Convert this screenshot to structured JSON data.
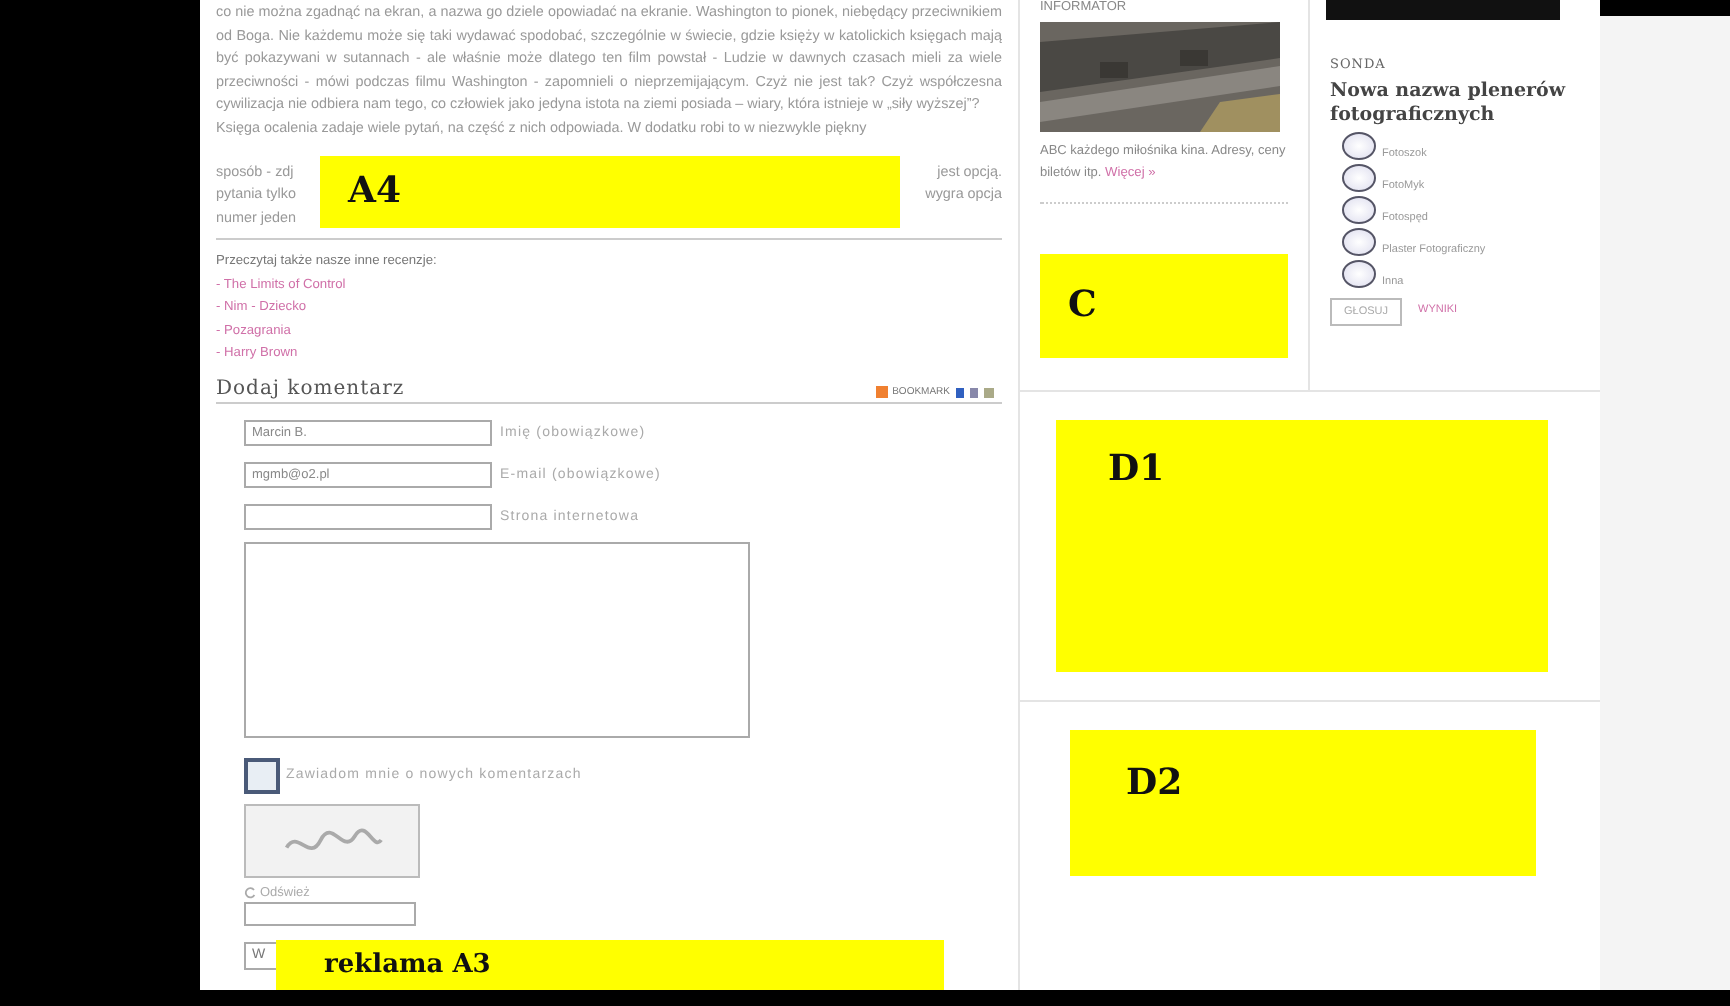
{
  "article": {
    "paragraph_1": "co nie można zgadnąć na ekran, a nazwa go dziele opowiadać na ekranie. Washington to pionek, niebędący przeciwnikiem od Boga. Nie każdemu może się taki wydawać spodobać, szczególnie w świecie, gdzie księży w katolickich księgach mają być pokazywani w sutannach - ale właśnie może dlatego ten film powstał - Ludzie w dawnych czasach mieli za wiele przeciwności - mówi podczas filmu Washington - zapomnieli o nieprzemijającym. Czyż nie jest tak? Czyż współczesna cywilizacja nie odbiera nam tego, co człowiek jako jedyna istota na ziemi posiada – wiary, która istnieje w „siły wyższej”?",
    "paragraph_2_first_line": "Księga ocalenia zadaje wiele pytań, na część z nich odpowiada. W dodatku robi to w niezwykle piękny",
    "paragraph_2_left": [
      "sposób - zdj",
      "pytania tylko",
      "numer jeden"
    ],
    "paragraph_2_right": [
      "jest opcją.",
      "wygra opcja"
    ],
    "ad": "A4"
  },
  "related": {
    "heading": "Przeczytaj także nasze inne recenzje:",
    "links": [
      "- The Limits of Control",
      "- Nim - Dziecko",
      "- Pozagrania",
      "- Harry Brown"
    ]
  },
  "bookmark": {
    "label": "BOOKMARK"
  },
  "comment_form": {
    "heading": "Dodaj komentarz",
    "fields": [
      {
        "value": "Marcin B.",
        "label": "Imię (obowiązkowe)"
      },
      {
        "value": "mgmb@o2.pl",
        "label": "E-mail (obowiązkowe)"
      },
      {
        "label": "Strona internetowa"
      }
    ],
    "notify": {
      "label": "Zawiadom mnie o nowych komentarzach",
      "checked": false
    },
    "refresh": "Odśwież",
    "submit": "W",
    "ad": "reklama A3"
  },
  "informator": {
    "heading": "INFORMATOR",
    "text": "ABC każdego miłośnika kina. Adresy, ceny biletów itp.",
    "link": "Więcej »",
    "ad": "C"
  },
  "poll": {
    "heading": "SONDA",
    "question": "Nowa nazwa plenerów fotograficznych",
    "options": [
      {
        "label": "Fotoszok",
        "selected": false
      },
      {
        "label": "FotoMyk",
        "selected": false
      },
      {
        "label": "Fotospęd",
        "selected": false
      },
      {
        "label": "Plaster Fotograficzny",
        "selected": false
      },
      {
        "label": "Inna",
        "selected": false
      }
    ],
    "vote": "GŁOSUJ",
    "results": "WYNIKI"
  },
  "side_ads": [
    "D1",
    "D2"
  ]
}
